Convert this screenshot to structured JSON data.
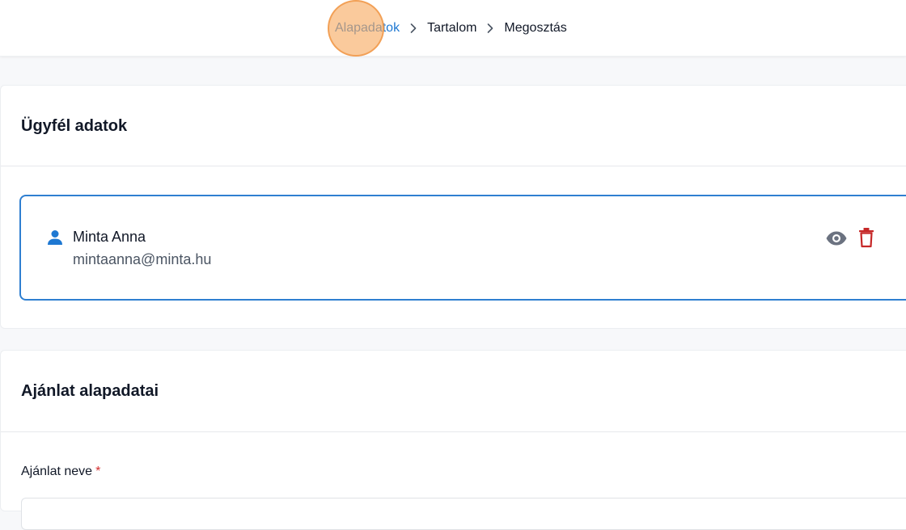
{
  "breadcrumb": {
    "steps": [
      "Alapadatok",
      "Tartalom",
      "Megosztás"
    ],
    "active_index": 0
  },
  "client_section": {
    "title": "Ügyfél adatok",
    "client": {
      "name": "Minta Anna",
      "email": "mintaanna@minta.hu"
    },
    "icons": {
      "person": "person-icon",
      "view": "eye-icon",
      "delete": "trash-icon"
    }
  },
  "offer_section": {
    "title": "Ajánlat alapadatai",
    "name_field": {
      "label": "Ajánlat neve",
      "required_mark": "*",
      "value": ""
    }
  },
  "colors": {
    "accent": "#1e78d2",
    "border_active": "#2f7fd1",
    "danger": "#c62828",
    "icon_gray": "#6b7280",
    "background": "#f7f8fa"
  }
}
